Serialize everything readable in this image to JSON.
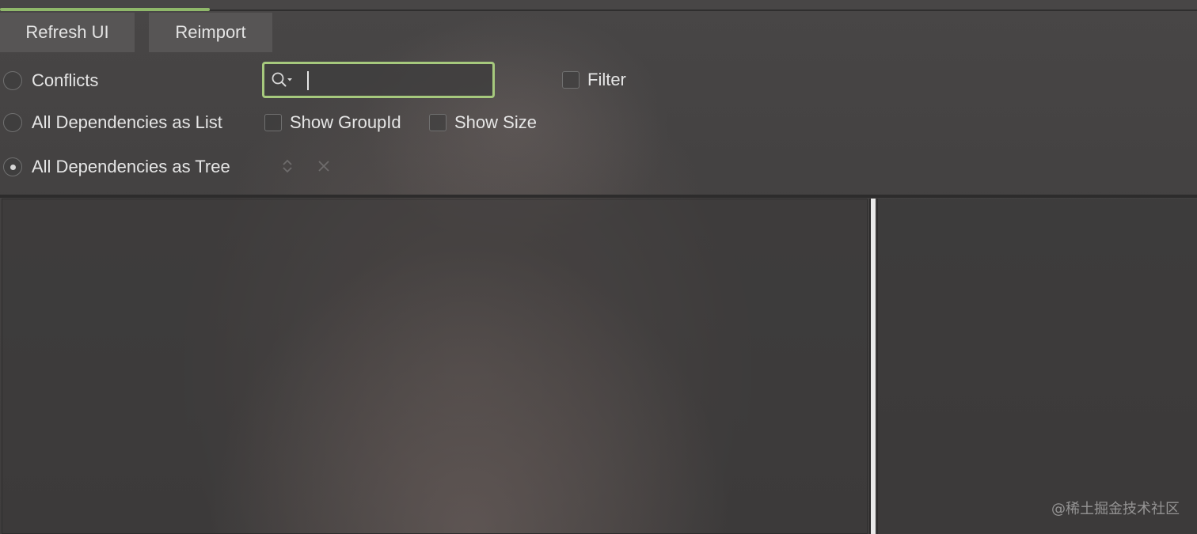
{
  "toolbar": {
    "refresh_label": "Refresh UI",
    "reimport_label": "Reimport"
  },
  "modes": {
    "conflicts_label": "Conflicts",
    "list_label": "All Dependencies as List",
    "tree_label": "All Dependencies as Tree",
    "selected": "All Dependencies as Tree"
  },
  "search": {
    "value": "",
    "placeholder": ""
  },
  "options": {
    "filter_label": "Filter",
    "show_groupid_label": "Show GroupId",
    "show_size_label": "Show Size"
  },
  "tree_controls": {
    "expand_icon": "expand-collapse-icon",
    "close_icon": "close-icon"
  },
  "watermark": "@稀土掘金技术社区",
  "colors": {
    "accent": "#a6c97d",
    "background": "#3b3a3a"
  }
}
